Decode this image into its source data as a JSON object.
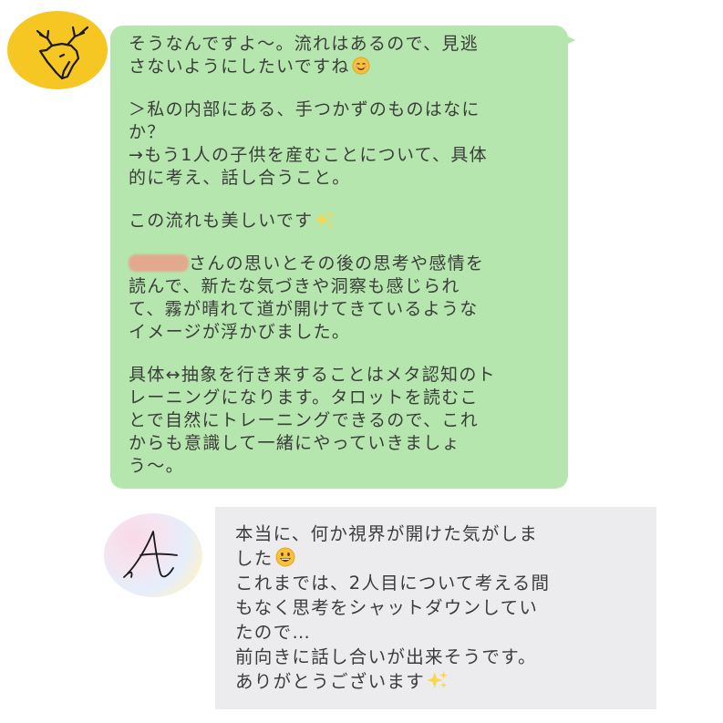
{
  "conversation": {
    "received": {
      "avatar_icon": "deer-head-icon",
      "avatar_color": "#f6c623",
      "bubble_color": "#b5e6ad",
      "para1": {
        "l1": "そうなんですよ〜。流れはあるので、見逃",
        "l2": "さないようにしたいですね",
        "l2_emoji": "smiling-face-emoji"
      },
      "para2": {
        "l1": "＞私の内部にある、手つかずのものはなに",
        "l2": "か？",
        "l3": "→もう1人の子供を産むことについて、具体",
        "l4": "的に考え、話し合うこと。"
      },
      "para3": {
        "l1": "この流れも美しいです",
        "l1_emoji": "sparkles-emoji"
      },
      "para4": {
        "redacted_name": "redacted-name",
        "l1_after": "さんの思いとその後の思考や感情を",
        "l2": "読んで、新たな気づきや洞察も感じられ",
        "l3": "て、霧が晴れて道が開けてきているような",
        "l4": "イメージが浮かびました。"
      },
      "para5": {
        "l1": "具体↔抽象を行き来することはメタ認知のト",
        "l2": "レーニングになります。タロットを読むこ",
        "l3": "とで自然にトレーニングできるので、これ",
        "l4": "からも意識して一緒にやっていきましょ",
        "l5": "う〜。"
      }
    },
    "sent": {
      "avatar_icon": "letter-a-signature-icon",
      "bubble_color": "#ececef",
      "l1": "本当に、何か視界が開けた気がしま",
      "l2": "した",
      "l2_emoji": "grinning-face-emoji",
      "l3": "これまでは、2人目について考える間",
      "l4": "もなく思考をシャットダウンしてい",
      "l5": "たので…",
      "l6": "前向きに話し合いが出来そうです。",
      "l7": "ありがとうございます",
      "l7_emoji": "sparkles-emoji"
    }
  }
}
